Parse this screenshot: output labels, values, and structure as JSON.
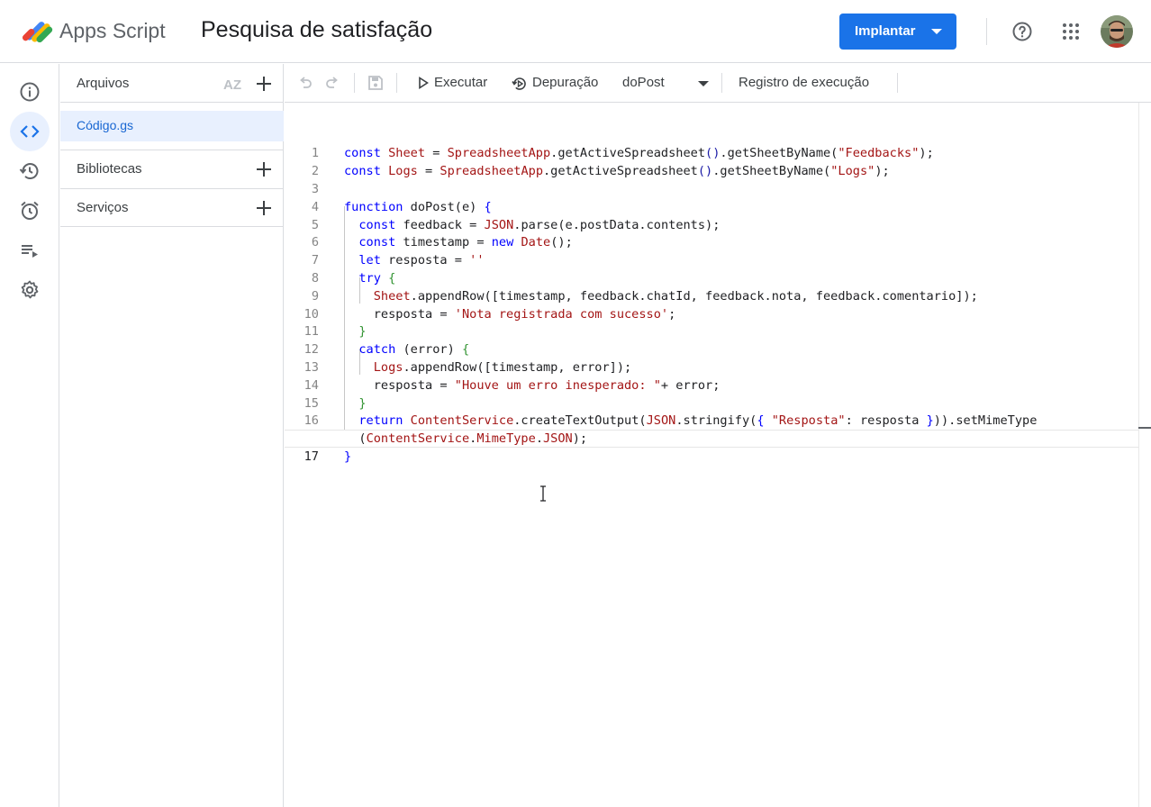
{
  "header": {
    "app_name": "Apps Script",
    "project_title": "Pesquisa de satisfação",
    "deploy_label": "Implantar",
    "accent": "#1a73e8"
  },
  "rail": {
    "items": [
      {
        "icon": "info-icon"
      },
      {
        "icon": "code-icon",
        "active": true
      },
      {
        "icon": "history-icon"
      },
      {
        "icon": "alarm-icon"
      },
      {
        "icon": "playlist-icon"
      },
      {
        "icon": "gear-icon"
      }
    ]
  },
  "files": {
    "header": "Arquivos",
    "sort_label": "AZ",
    "items": [
      "Código.gs"
    ],
    "libraries": "Bibliotecas",
    "services": "Serviços"
  },
  "toolbar": {
    "run": "Executar",
    "debug": "Depuração",
    "function": "doPost",
    "log": "Registro de execução"
  },
  "editor": {
    "line_numbers": [
      "1",
      "2",
      "3",
      "4",
      "5",
      "6",
      "7",
      "8",
      "9",
      "10",
      "11",
      "12",
      "13",
      "14",
      "15",
      "16",
      "",
      "17"
    ],
    "current_line": "17"
  }
}
